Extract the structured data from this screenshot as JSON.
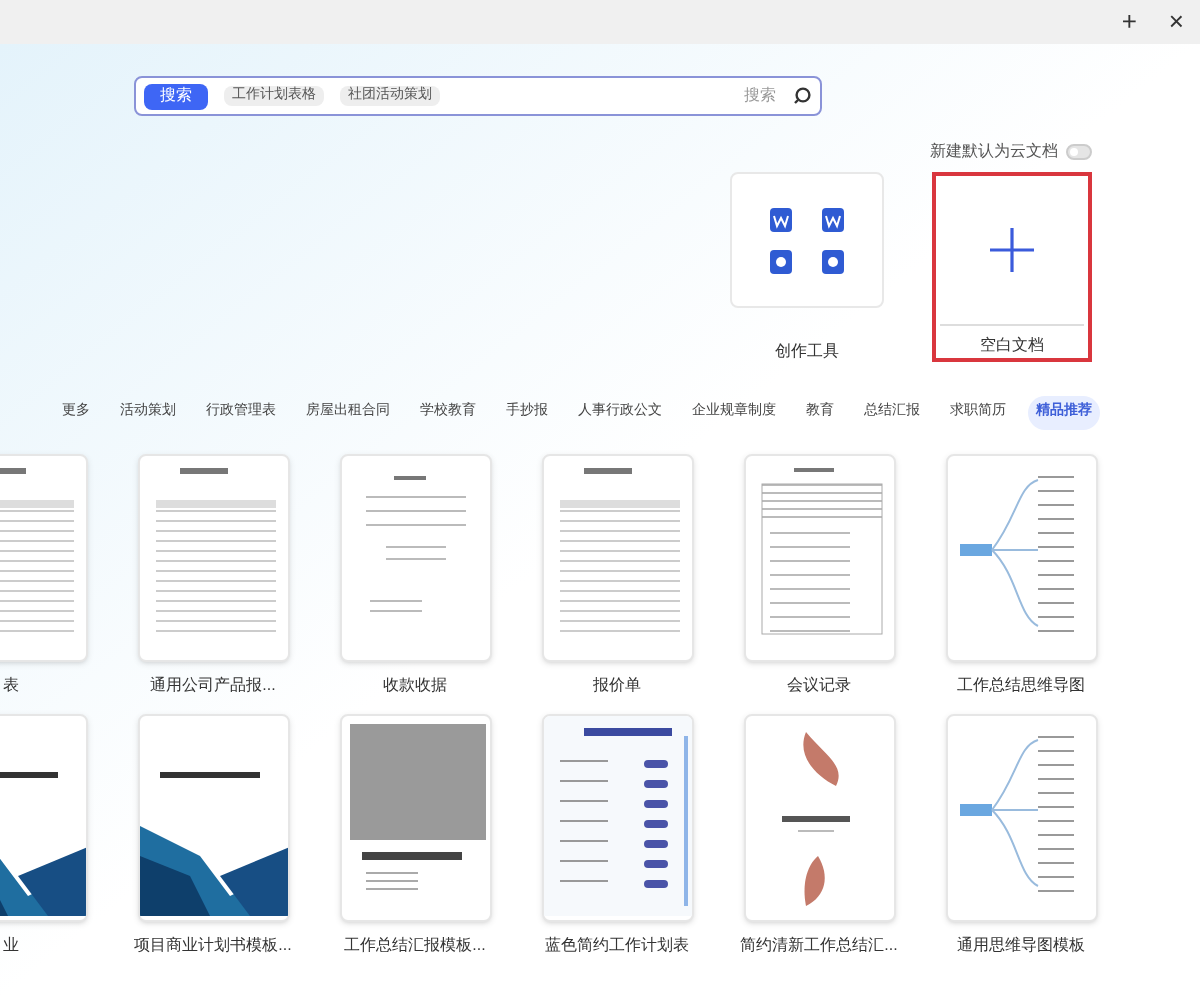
{
  "window": {
    "controls": [
      "+",
      "×"
    ]
  },
  "search": {
    "button": "搜索",
    "tags": [
      "工作计划表格",
      "社团活动策划"
    ],
    "action": "搜索"
  },
  "toggle": {
    "label": "新建默认为云文档",
    "on": false
  },
  "new_cards": [
    {
      "label": "创作工具",
      "kind": "tools",
      "selected": false
    },
    {
      "label": "空白文档",
      "kind": "blank",
      "selected": true
    }
  ],
  "categories": [
    {
      "label": "更多",
      "selected": false
    },
    {
      "label": "活动策划",
      "selected": false
    },
    {
      "label": "行政管理表",
      "selected": false
    },
    {
      "label": "房屋出租合同",
      "selected": false
    },
    {
      "label": "学校教育",
      "selected": false
    },
    {
      "label": "手抄报",
      "selected": false
    },
    {
      "label": "人事行政公文",
      "selected": false
    },
    {
      "label": "企业规章制度",
      "selected": false
    },
    {
      "label": "教育",
      "selected": false
    },
    {
      "label": "总结汇报",
      "selected": false
    },
    {
      "label": "求职简历",
      "selected": false
    },
    {
      "label": "精品推荐",
      "selected": true
    }
  ],
  "templates": [
    {
      "label": "表",
      "kind": "table"
    },
    {
      "label": "通用公司产品报...",
      "kind": "table"
    },
    {
      "label": "收款收据",
      "kind": "letter"
    },
    {
      "label": "报价单",
      "kind": "table"
    },
    {
      "label": "会议记录",
      "kind": "form"
    },
    {
      "label": "工作总结思维导图",
      "kind": "mindmap"
    },
    {
      "label": "业",
      "kind": "geo"
    },
    {
      "label": "项目商业计划书模板...",
      "kind": "geo"
    },
    {
      "label": "工作总结汇报模板...",
      "kind": "photo"
    },
    {
      "label": "蓝色简约工作计划表",
      "kind": "plan"
    },
    {
      "label": "简约清新工作总结汇...",
      "kind": "floral"
    },
    {
      "label": "通用思维导图模板",
      "kind": "mindmap"
    }
  ]
}
